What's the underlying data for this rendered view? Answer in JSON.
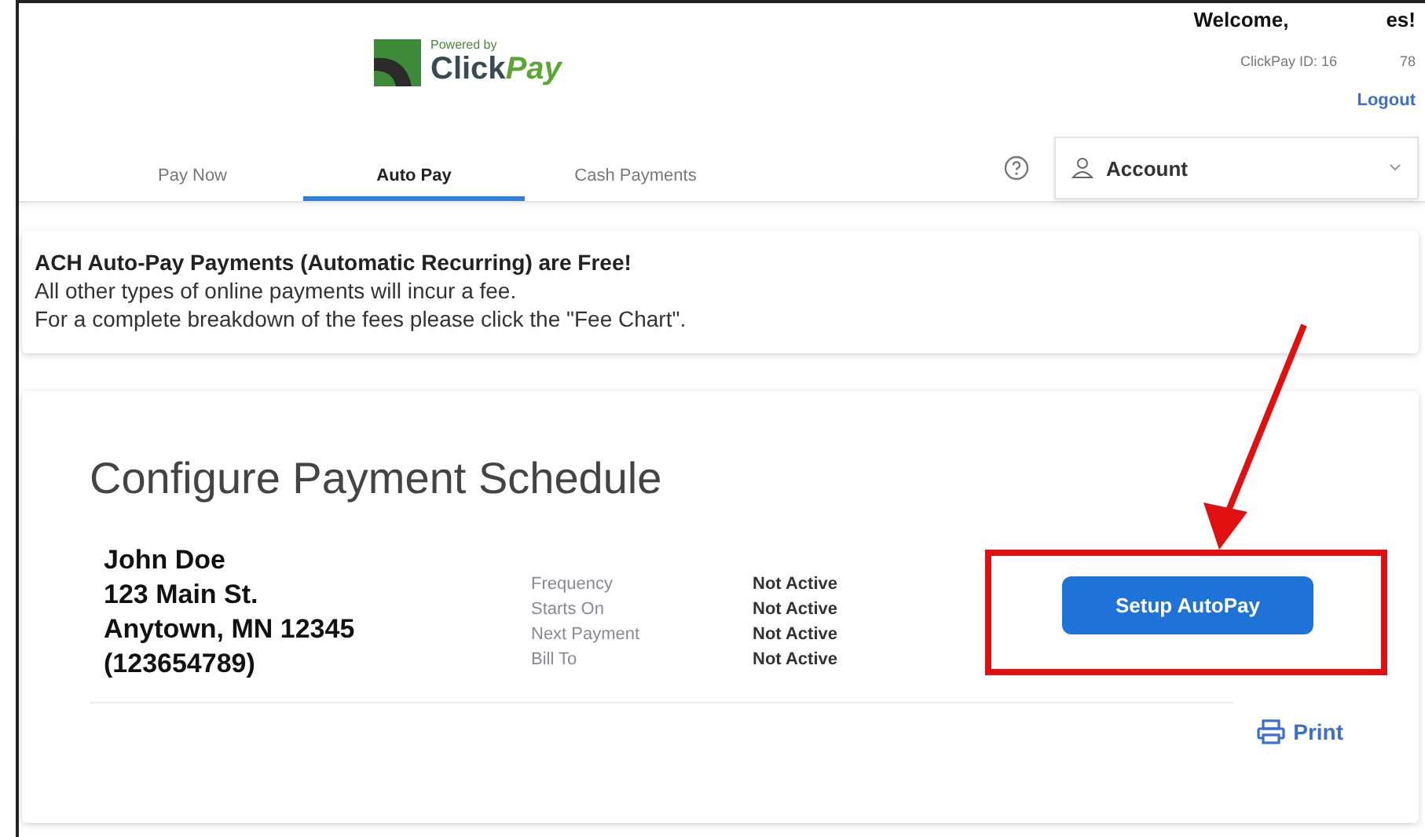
{
  "header": {
    "logo": {
      "tagline": "Powered by",
      "brand_first": "Click",
      "brand_second": "Pay"
    },
    "welcome": "Welcome,",
    "welcome_tail": "es!",
    "clickpay_id": "ClickPay ID: 16",
    "clickpay_id_tail": "78",
    "logout": "Logout"
  },
  "tabs": [
    {
      "label": "Pay Now",
      "selected": false
    },
    {
      "label": "Auto Pay",
      "selected": true
    },
    {
      "label": "Cash Payments",
      "selected": false
    }
  ],
  "account": {
    "label": "Account"
  },
  "notice": {
    "headline": "ACH Auto-Pay Payments (Automatic Recurring) are Free!",
    "lines": [
      "All other types of online payments will incur a fee.",
      "For a complete breakdown of the fees please click the \"Fee Chart\"."
    ]
  },
  "schedule": {
    "title": "Configure Payment Schedule",
    "address": [
      "John Doe",
      "123 Main St.",
      "Anytown, MN 12345",
      "(123654789)"
    ],
    "fields": [
      {
        "label": "Frequency",
        "value": "Not Active"
      },
      {
        "label": "Starts On",
        "value": "Not Active"
      },
      {
        "label": "Next Payment",
        "value": "Not Active"
      },
      {
        "label": "Bill To",
        "value": "Not Active"
      }
    ],
    "button": "Setup AutoPay",
    "print": "Print"
  }
}
